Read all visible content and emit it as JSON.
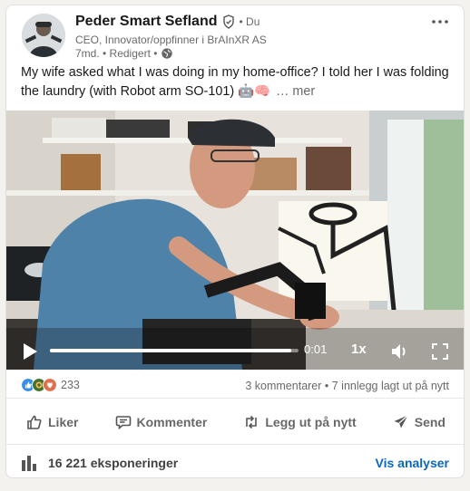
{
  "post": {
    "author_name": "Peder Smart Sefland",
    "connection_degree": "• Du",
    "headline": "CEO, Innovator/oppfinner i BrAInXR AS",
    "time_edited": "7md. • Redigert •",
    "text": "My wife asked what I was doing in my home-office? I told her I was folding the laundry (with Robot arm SO-101) 🤖🧠",
    "see_more": "… mer"
  },
  "video": {
    "time": "0:01",
    "speed": "1x",
    "progress": 0.97
  },
  "social": {
    "reaction_count": "233",
    "comments_reposts": "3 kommentarer • 7 innlegg lagt ut på nytt",
    "reactions": [
      "like",
      "celebrate",
      "love"
    ]
  },
  "actions": {
    "like": "Liker",
    "comment": "Kommenter",
    "repost": "Legg ut på nytt",
    "send": "Send"
  },
  "footer": {
    "impressions": "16 221 eksponeringer",
    "analytics": "Vis analyser"
  },
  "colors": {
    "link": "#0a66c2",
    "like": "#378fe9",
    "celebrate": "#44712e",
    "love": "#df704d"
  }
}
